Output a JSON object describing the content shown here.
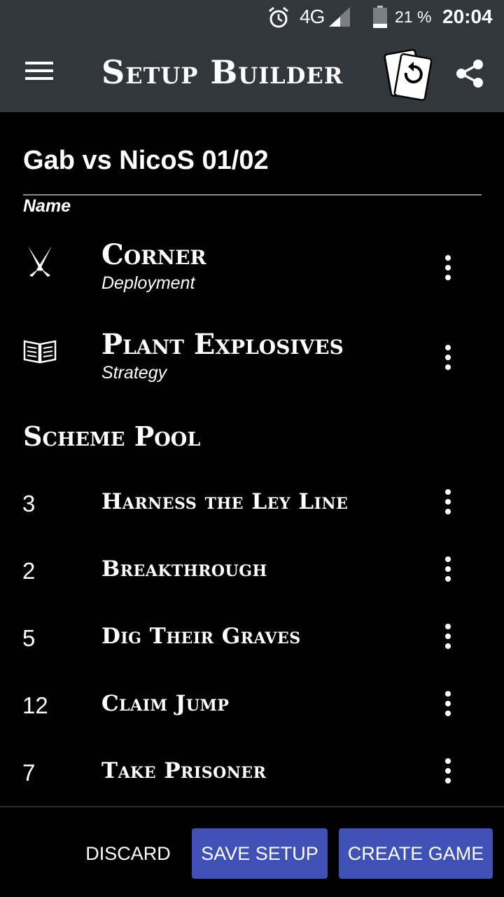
{
  "status_bar": {
    "network": "4G",
    "battery_percent": "21 %",
    "battery_level": 0.21,
    "time": "20:04",
    "icons": [
      "alarm-icon",
      "signal-icon",
      "battery-icon"
    ]
  },
  "app_bar": {
    "title": "Setup Builder",
    "icons": [
      "menu-icon",
      "cards-undo-icon",
      "share-icon"
    ]
  },
  "setup": {
    "name_value": "Gab vs NicoS 01/02",
    "name_label": "Name"
  },
  "details": [
    {
      "icon": "crossed-blades-icon",
      "title": "Corner",
      "subtitle": "Deployment"
    },
    {
      "icon": "open-book-icon",
      "title": "Plant Explosives",
      "subtitle": "Strategy"
    }
  ],
  "scheme_pool": {
    "heading": "Scheme Pool",
    "items": [
      {
        "number": "3",
        "name": "Harness the Ley Line"
      },
      {
        "number": "2",
        "name": "Breakthrough"
      },
      {
        "number": "5",
        "name": "Dig Their Graves"
      },
      {
        "number": "12",
        "name": "Claim Jump"
      },
      {
        "number": "7",
        "name": "Take Prisoner"
      }
    ]
  },
  "actions": {
    "discard": "DISCARD",
    "save": "SAVE SETUP",
    "create": "CREATE GAME"
  },
  "colors": {
    "bar_background": "#31373d",
    "background": "#000000",
    "primary_button": "#3f51b5",
    "text": "#ffffff"
  }
}
